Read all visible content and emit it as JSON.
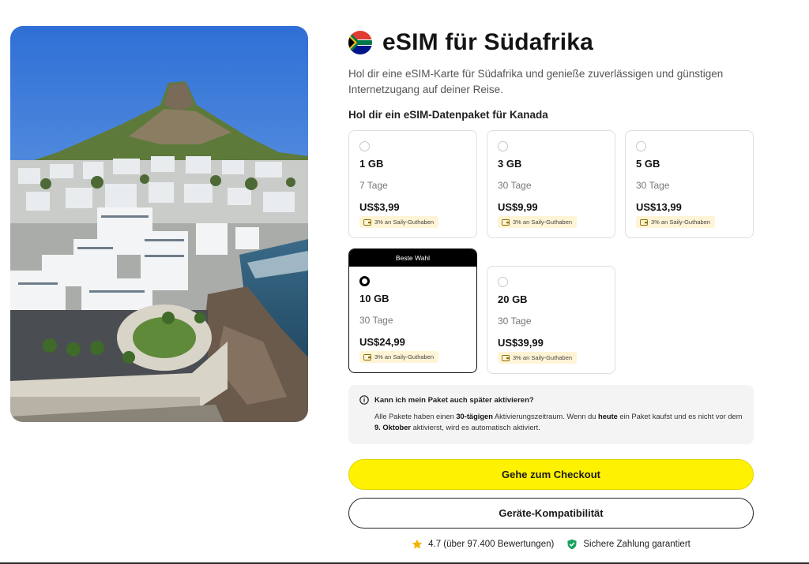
{
  "header": {
    "title": "eSIM für Südafrika",
    "subtitle": "Hol dir eine eSIM-Karte für Südafrika und genieße zuverlässigen und günstigen Internetzugang auf deiner Reise.",
    "flag_icon": "south-africa-flag-icon"
  },
  "plans_section": {
    "heading": "Hol dir ein eSIM-Datenpaket für Kanada",
    "best_choice_label": "Beste Wahl",
    "selected_index": 3,
    "plans": [
      {
        "size": "1 GB",
        "days": "7 Tage",
        "price": "US$3,99",
        "credit": "3% an Saily-Guthaben"
      },
      {
        "size": "3 GB",
        "days": "30 Tage",
        "price": "US$9,99",
        "credit": "3% an Saily-Guthaben"
      },
      {
        "size": "5 GB",
        "days": "30 Tage",
        "price": "US$13,99",
        "credit": "3% an Saily-Guthaben"
      },
      {
        "size": "10 GB",
        "days": "30 Tage",
        "price": "US$24,99",
        "credit": "3% an Saily-Guthaben"
      },
      {
        "size": "20 GB",
        "days": "30 Tage",
        "price": "US$39,99",
        "credit": "3% an Saily-Guthaben"
      }
    ]
  },
  "info": {
    "title": "Kann ich mein Paket auch später aktivieren?",
    "text_1": "Alle Pakete haben einen ",
    "text_bold_1": "30-tägigen",
    "text_2": " Aktivierungszeitraum. Wenn du ",
    "text_bold_2": "heute",
    "text_3": " ein Paket kaufst und es nicht vor dem ",
    "text_bold_3": "9. Oktober",
    "text_4": " aktivierst, wird es automatisch aktiviert."
  },
  "actions": {
    "checkout_label": "Gehe zum Checkout",
    "compat_label": "Geräte-Kompatibilität"
  },
  "trust": {
    "rating": "4.7 (über 97.400 Bewertungen)",
    "secure": "Sichere Zahlung garantiert"
  },
  "colors": {
    "accent_yellow": "#fff200",
    "badge_bg": "#fff4d6",
    "shield_green": "#1aa260",
    "star_gold": "#f2b400"
  }
}
